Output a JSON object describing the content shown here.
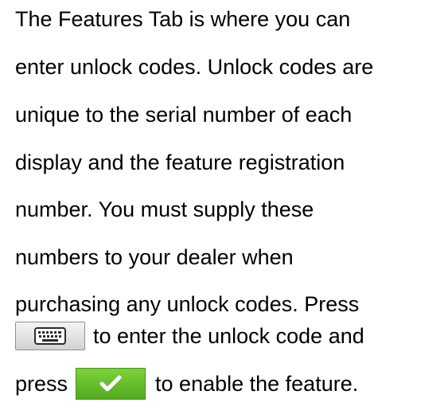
{
  "paragraph": {
    "lines": [
      "The Features Tab is where you can",
      "enter unlock codes. Unlock codes are",
      "unique to the serial number of each",
      "display and the feature registration",
      "number. You must supply these",
      "numbers to your dealer when",
      "purchasing any unlock codes. Press"
    ],
    "keyboard_suffix": "to enter the unlock code and",
    "accept_prefix": "press",
    "accept_suffix": "to enable the feature."
  },
  "icons": {
    "keyboard": "keyboard-icon",
    "accept": "checkmark-icon"
  },
  "colors": {
    "accept_button": "#5cb82a",
    "keyboard_button": "#e3e3e3"
  }
}
